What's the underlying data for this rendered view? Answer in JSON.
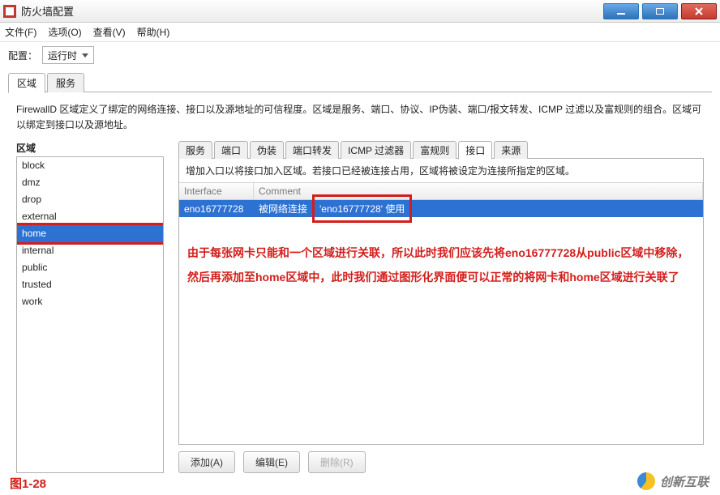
{
  "window": {
    "title": "防火墙配置"
  },
  "menu": {
    "file": "文件(F)",
    "options": "选项(O)",
    "view": "查看(V)",
    "help": "帮助(H)"
  },
  "config": {
    "label": "配置：",
    "value": "运行时"
  },
  "outer_tabs": {
    "zones": "区域",
    "services": "服务"
  },
  "description": "FirewallD 区域定义了绑定的网络连接、接口以及源地址的可信程度。区域是服务、端口、协议、IP伪装、端口/报文转发、ICMP 过滤以及富规则的组合。区域可以绑定到接口以及源地址。",
  "zones_heading": "区域",
  "zones": [
    "block",
    "dmz",
    "drop",
    "external",
    "home",
    "internal",
    "public",
    "trusted",
    "work"
  ],
  "zone_selected_index": 4,
  "inner_tabs": {
    "services": "服务",
    "ports": "端口",
    "masq": "伪装",
    "port_fw": "端口转发",
    "icmp": "ICMP 过滤器",
    "rich": "富规则",
    "ifaces": "接口",
    "sources": "来源"
  },
  "inner_active": "ifaces",
  "inner_desc": "增加入口以将接口加入区域。若接口已经被连接占用，区域将被设定为连接所指定的区域。",
  "table": {
    "col_interface": "Interface",
    "col_comment": "Comment",
    "row": {
      "interface": "eno16777728",
      "comment_a": "被网络连接",
      "comment_b": "'eno16777728' 使用"
    }
  },
  "red_text": "由于每张网卡只能和一个区域进行关联，所以此时我们应该先将eno16777728从public区域中移除，然后再添加至home区域中，此时我们通过图形化界面便可以正常的将网卡和home区域进行关联了",
  "buttons": {
    "add": "添加(A)",
    "edit": "编辑(E)",
    "remove": "删除(R)"
  },
  "figure_label": "图1-28",
  "watermark": "创新互联"
}
